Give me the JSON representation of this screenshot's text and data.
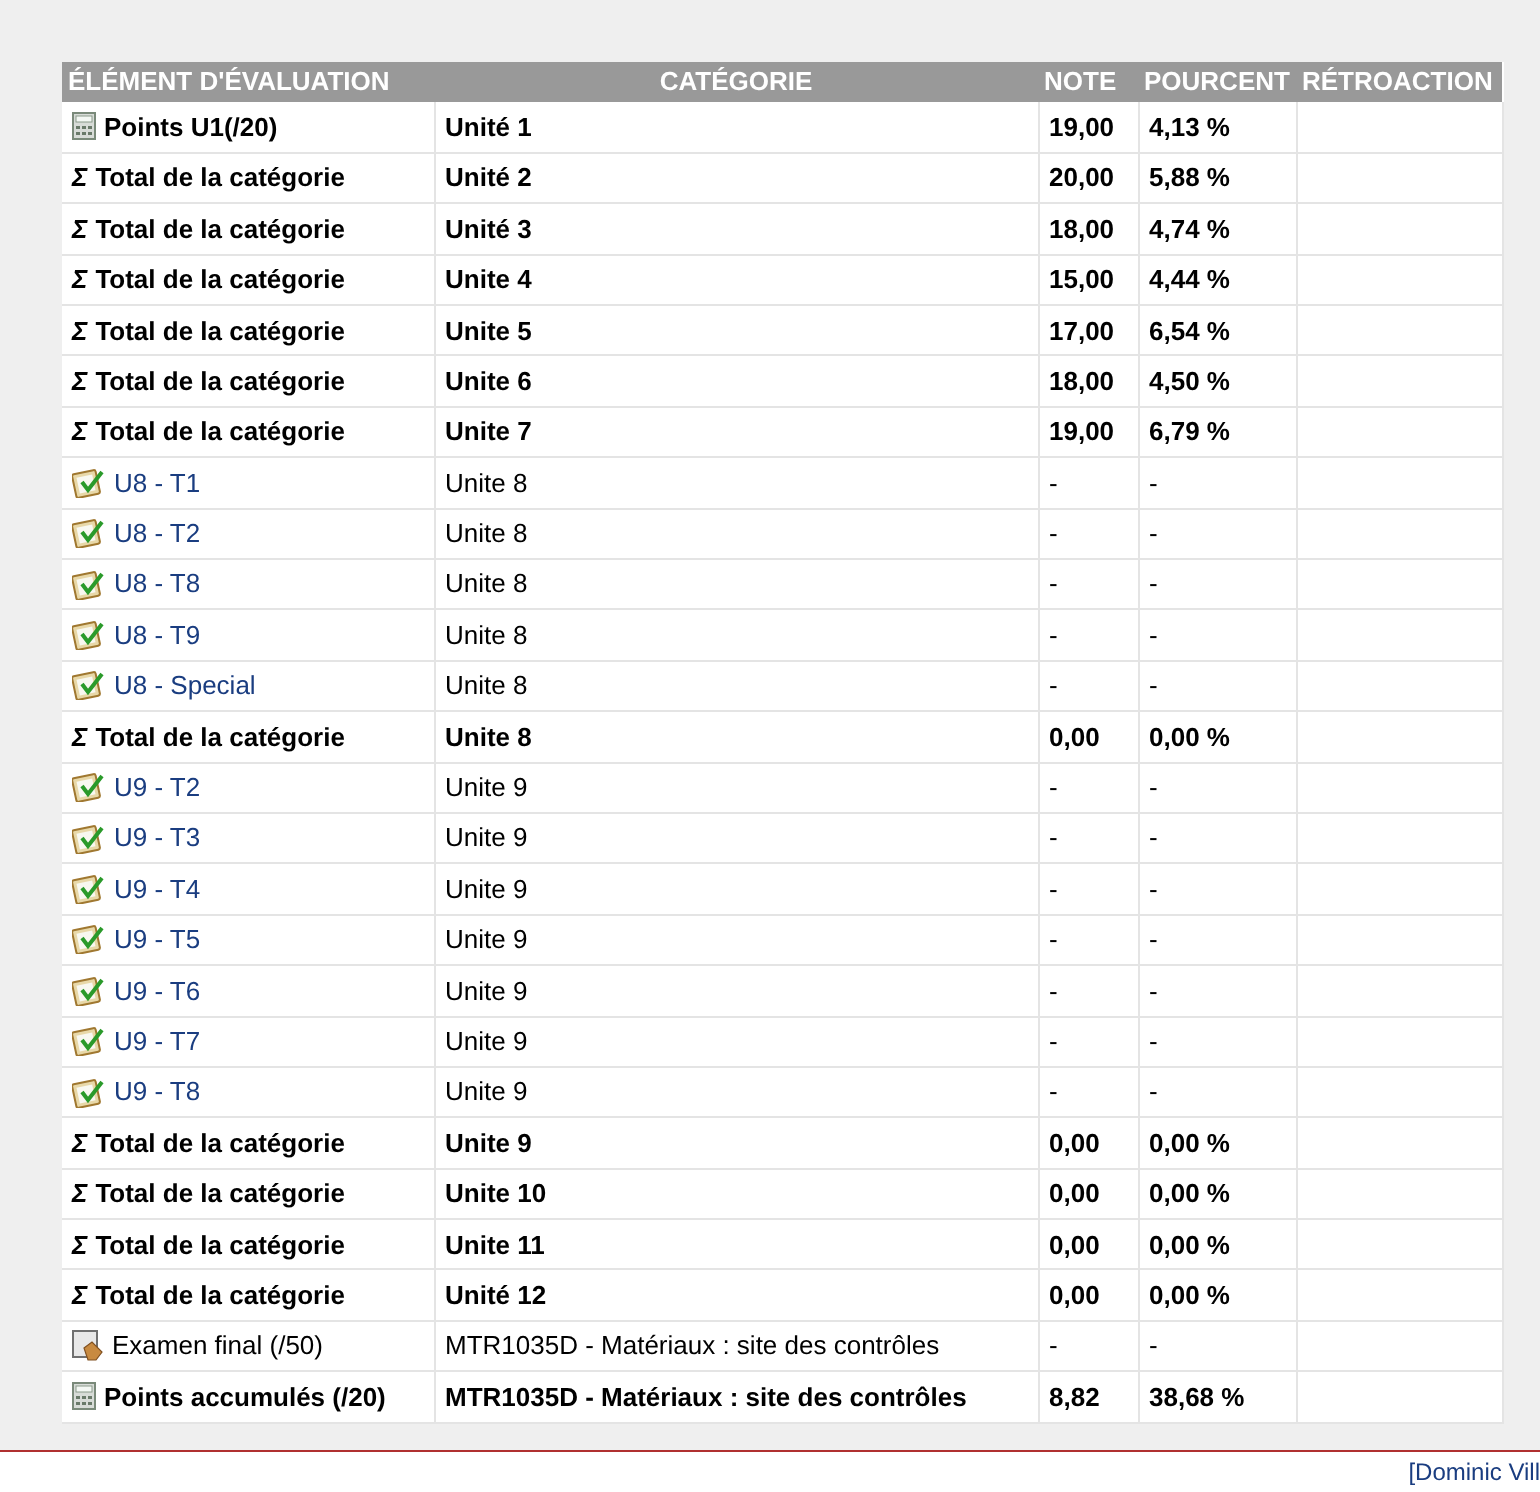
{
  "table": {
    "columns": [
      "ÉLÉMENT D'ÉVALUATION",
      "CATÉGORIE",
      "NOTE",
      "POURCENT",
      "RÉTROACTION"
    ],
    "rows": [
      {
        "kind": "calculated",
        "item": "Points U1(/20)",
        "category": "Unité 1",
        "grade": "19,00",
        "percent": "4,13 %"
      },
      {
        "kind": "total",
        "symbol": "Σ",
        "item": "Total de la catégorie",
        "category": "Unité 2",
        "grade": "20,00",
        "percent": "5,88 %"
      },
      {
        "kind": "total",
        "symbol": "Σ",
        "item": "Total de la catégorie",
        "category": "Unité 3",
        "grade": "18,00",
        "percent": "4,74 %"
      },
      {
        "kind": "total",
        "symbol": "Σ",
        "item": "Total de la catégorie",
        "category": "Unite 4",
        "grade": "15,00",
        "percent": "4,44 %"
      },
      {
        "kind": "total",
        "symbol": "Σ",
        "item": "Total de la catégorie",
        "category": "Unite 5",
        "grade": "17,00",
        "percent": "6,54 %"
      },
      {
        "kind": "total",
        "symbol": "Σ",
        "item": "Total de la catégorie",
        "category": "Unite 6",
        "grade": "18,00",
        "percent": "4,50 %"
      },
      {
        "kind": "total",
        "symbol": "Σ",
        "item": "Total de la catégorie",
        "category": "Unite 7",
        "grade": "19,00",
        "percent": "6,79 %"
      },
      {
        "kind": "quiz",
        "item": "U8 - T1",
        "category": "Unite 8",
        "grade": "-",
        "percent": "-"
      },
      {
        "kind": "quiz",
        "item": "U8 - T2",
        "category": "Unite 8",
        "grade": "-",
        "percent": "-"
      },
      {
        "kind": "quiz",
        "item": "U8 - T8",
        "category": "Unite 8",
        "grade": "-",
        "percent": "-"
      },
      {
        "kind": "quiz",
        "item": "U8 - T9",
        "category": "Unite 8",
        "grade": "-",
        "percent": "-"
      },
      {
        "kind": "quiz",
        "item": "U8 - Special",
        "category": "Unite 8",
        "grade": "-",
        "percent": "-"
      },
      {
        "kind": "total",
        "symbol": "Σ",
        "item": "Total de la catégorie",
        "category": "Unite 8",
        "grade": "0,00",
        "percent": "0,00 %"
      },
      {
        "kind": "quiz",
        "item": "U9 - T2",
        "category": "Unite 9",
        "grade": "-",
        "percent": "-"
      },
      {
        "kind": "quiz",
        "item": "U9 - T3",
        "category": "Unite 9",
        "grade": "-",
        "percent": "-"
      },
      {
        "kind": "quiz",
        "item": "U9 - T4",
        "category": "Unite 9",
        "grade": "-",
        "percent": "-"
      },
      {
        "kind": "quiz",
        "item": "U9 - T5",
        "category": "Unite 9",
        "grade": "-",
        "percent": "-"
      },
      {
        "kind": "quiz",
        "item": "U9 - T6",
        "category": "Unite 9",
        "grade": "-",
        "percent": "-"
      },
      {
        "kind": "quiz",
        "item": "U9 - T7",
        "category": "Unite 9",
        "grade": "-",
        "percent": "-"
      },
      {
        "kind": "quiz",
        "item": "U9 - T8",
        "category": "Unite 9",
        "grade": "-",
        "percent": "-"
      },
      {
        "kind": "total",
        "symbol": "Σ",
        "item": "Total de la catégorie",
        "category": "Unite 9",
        "grade": "0,00",
        "percent": "0,00 %"
      },
      {
        "kind": "total",
        "symbol": "Σ",
        "item": "Total de la catégorie",
        "category": "Unite 10",
        "grade": "0,00",
        "percent": "0,00 %"
      },
      {
        "kind": "total",
        "symbol": "Σ",
        "item": "Total de la catégorie",
        "category": "Unite 11",
        "grade": "0,00",
        "percent": "0,00 %"
      },
      {
        "kind": "total",
        "symbol": "Σ",
        "item": "Total de la catégorie",
        "category": "Unité 12",
        "grade": "0,00",
        "percent": "0,00 %"
      },
      {
        "kind": "manual",
        "item": "Examen final (/50)",
        "category": "MTR1035D - Matériaux : site des contrôles",
        "grade": "-",
        "percent": "-"
      },
      {
        "kind": "calculated",
        "item": "Points accumulés (/20)",
        "category": "MTR1035D - Matériaux : site des contrôles",
        "grade": "8,82",
        "percent": "38,68 %"
      }
    ]
  },
  "footer": {
    "user_link": "[Dominic Vill"
  }
}
